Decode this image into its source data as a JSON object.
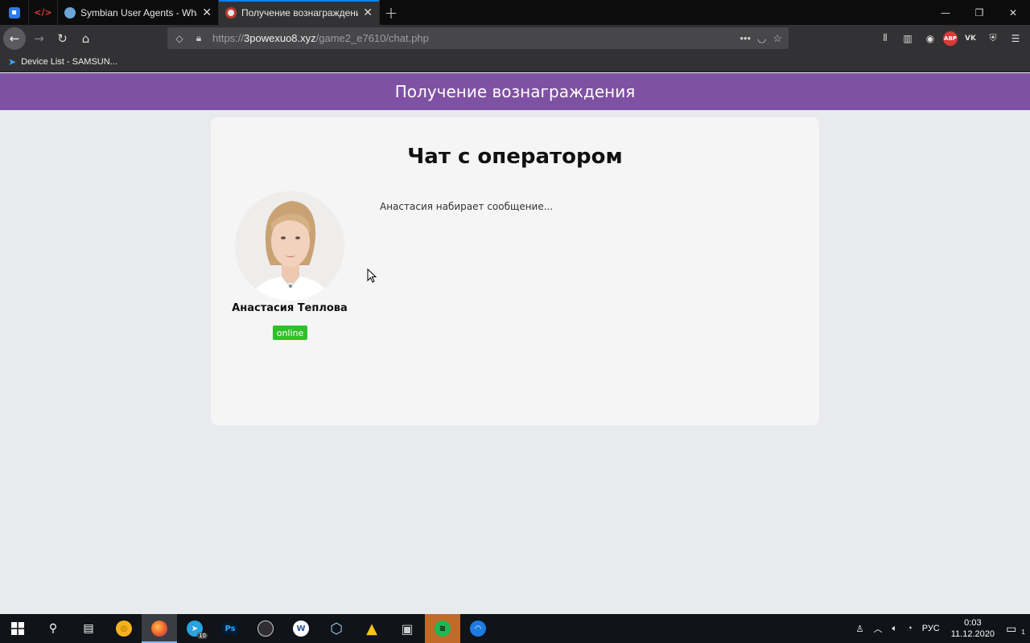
{
  "browser": {
    "tabs": [
      {
        "label": "Symbian User Agents - WhatIsMyBrowser",
        "active": false
      },
      {
        "label": "Получение вознаграждения",
        "active": true
      }
    ],
    "url_prefix": "https://",
    "url_domain": "3powexuo8.xyz",
    "url_path": "/game2_e7610/chat.php",
    "bookmark": "Device List - SAMSUN..."
  },
  "page": {
    "header_title": "Получение вознаграждения",
    "card_title": "Чат с оператором",
    "operator_name": "Анастасия Теплова",
    "status": "online",
    "typing_message": "Анастасия набирает сообщение..."
  },
  "taskbar": {
    "language": "РУС",
    "time": "0:03",
    "date": "11.12.2020",
    "telegram_badge": "10",
    "notification_count": "1"
  },
  "colors": {
    "header_purple": "#7f51a3",
    "online_green": "#2ec22a",
    "page_bg": "#e9eaee"
  }
}
